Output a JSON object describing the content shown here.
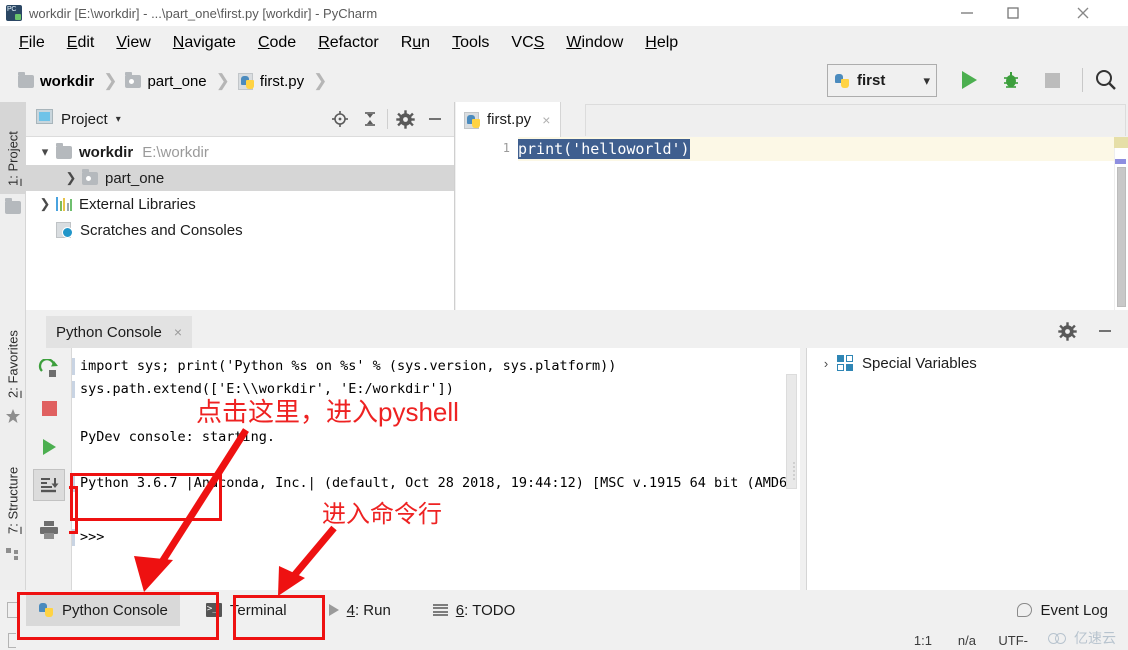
{
  "window": {
    "title": "workdir [E:\\workdir] - ...\\part_one\\first.py [workdir] - PyCharm",
    "app_icon": "pycharm-icon",
    "minimize": "minimize-icon",
    "maximize": "maximize-icon",
    "close": "close-icon"
  },
  "menubar": {
    "items": [
      {
        "label": "File",
        "mnemonic": "F"
      },
      {
        "label": "Edit",
        "mnemonic": "E"
      },
      {
        "label": "View",
        "mnemonic": "V"
      },
      {
        "label": "Navigate",
        "mnemonic": "N"
      },
      {
        "label": "Code",
        "mnemonic": "C"
      },
      {
        "label": "Refactor",
        "mnemonic": "R"
      },
      {
        "label": "Run",
        "mnemonic": "u"
      },
      {
        "label": "Tools",
        "mnemonic": "T"
      },
      {
        "label": "VCS",
        "mnemonic": "S"
      },
      {
        "label": "Window",
        "mnemonic": "W"
      },
      {
        "label": "Help",
        "mnemonic": "H"
      }
    ]
  },
  "breadcrumb": {
    "items": [
      {
        "label": "workdir",
        "icon": "folder-icon",
        "bold": true
      },
      {
        "label": "part_one",
        "icon": "source-folder-icon",
        "bold": false
      },
      {
        "label": "first.py",
        "icon": "python-file-icon",
        "bold": false
      }
    ],
    "separator": "›"
  },
  "toolbar": {
    "run_config": "first",
    "run_config_icon": "python-icon",
    "dropdown_caret": "⌄",
    "run_button": "run-icon",
    "debug_button": "debug-icon",
    "stop_button": "stop-icon",
    "search_button": "search-icon"
  },
  "left_strip": {
    "tabs": [
      {
        "label": "1: Project",
        "mnemonic": "1",
        "selected": true,
        "icon": "folder-icon"
      },
      {
        "label": "2: Favorites",
        "mnemonic": "2",
        "selected": false,
        "icon": "star-icon"
      },
      {
        "label": "7: Structure",
        "mnemonic": "7",
        "selected": false,
        "icon": "structure-icon"
      }
    ]
  },
  "project_panel": {
    "title": "Project",
    "caret": "▾",
    "panel_icon": "project-window-icon",
    "buttons": [
      {
        "name": "locate-icon"
      },
      {
        "name": "collapse-all-icon"
      },
      {
        "name": "gear-icon"
      },
      {
        "name": "hide-icon"
      }
    ],
    "tree": [
      {
        "label": "workdir",
        "path": "E:\\workdir",
        "twisty": "⌄",
        "icon": "folder-icon",
        "bold": true,
        "selected": false,
        "indent": 0
      },
      {
        "label": "part_one",
        "path": "",
        "twisty": "›",
        "icon": "source-folder-icon",
        "bold": false,
        "selected": true,
        "indent": 1
      },
      {
        "label": "External Libraries",
        "path": "",
        "twisty": "›",
        "icon": "libraries-icon",
        "bold": false,
        "selected": false,
        "indent": 0
      },
      {
        "label": "Scratches and Consoles",
        "path": "",
        "twisty": "",
        "icon": "scratches-icon",
        "bold": false,
        "selected": false,
        "indent": 0
      }
    ]
  },
  "editor": {
    "tab": {
      "label": "first.py",
      "icon": "python-file-icon",
      "close": "×"
    },
    "line_number": "1",
    "code": "print('helloworld')",
    "code_selected": true,
    "marker_warning_color": "#e6dfa8",
    "marker_info_color": "#8e8ee0"
  },
  "console": {
    "tab": {
      "label": "Python Console",
      "close": "×"
    },
    "gear": "gear-icon",
    "minimize": "minimize-icon",
    "tool_buttons": [
      {
        "name": "rerun-icon"
      },
      {
        "name": "stop-icon"
      },
      {
        "name": "execute-icon"
      },
      {
        "name": "soft-wrap-icon",
        "selected": true
      },
      {
        "name": "print-icon"
      }
    ],
    "output": [
      "import sys; print('Python %s on %s' % (sys.version, sys.platform))",
      "sys.path.extend(['E:\\\\workdir', 'E:/workdir'])",
      "PyDev console: starting.",
      "Python 3.6.7 |Anaconda, Inc.| (default, Oct 28 2018, 19:44:12) [MSC v.1915 64 bit (AMD6"
    ],
    "prompt": ">>>",
    "variables": {
      "label": "Special Variables",
      "twisty": "›",
      "icon": "special-variables-icon"
    }
  },
  "bottom_bar": {
    "tabs": [
      {
        "label": "Python Console",
        "icon": "python-icon",
        "selected": true,
        "mnemonic": ""
      },
      {
        "label": "Terminal",
        "icon": "terminal-icon",
        "selected": false,
        "mnemonic": ""
      },
      {
        "label": "4: Run",
        "icon": "run-small-icon",
        "selected": false,
        "mnemonic": "4"
      },
      {
        "label": "6: TODO",
        "icon": "todo-icon",
        "selected": false,
        "mnemonic": "6"
      }
    ],
    "event_log": {
      "label": "Event Log",
      "icon": "balloon-icon"
    }
  },
  "status_bar": {
    "caret_position": "1:1",
    "line_separator": "n/a",
    "encoding": "UTF-"
  },
  "annotations": {
    "color": "#ee1111",
    "note_1": "点击这里，进入pyshell",
    "note_2": "进入命令行",
    "boxes": [
      {
        "name": "python-version-line-box"
      },
      {
        "name": "python-console-tab-box"
      },
      {
        "name": "terminal-tab-box"
      },
      {
        "name": "soft-wrap-button-box"
      }
    ],
    "arrows": [
      {
        "name": "arrow-to-python-console-tab"
      },
      {
        "name": "arrow-to-terminal-tab"
      }
    ]
  },
  "watermark": {
    "text": "亿速云",
    "icon": "cloud-icon"
  }
}
